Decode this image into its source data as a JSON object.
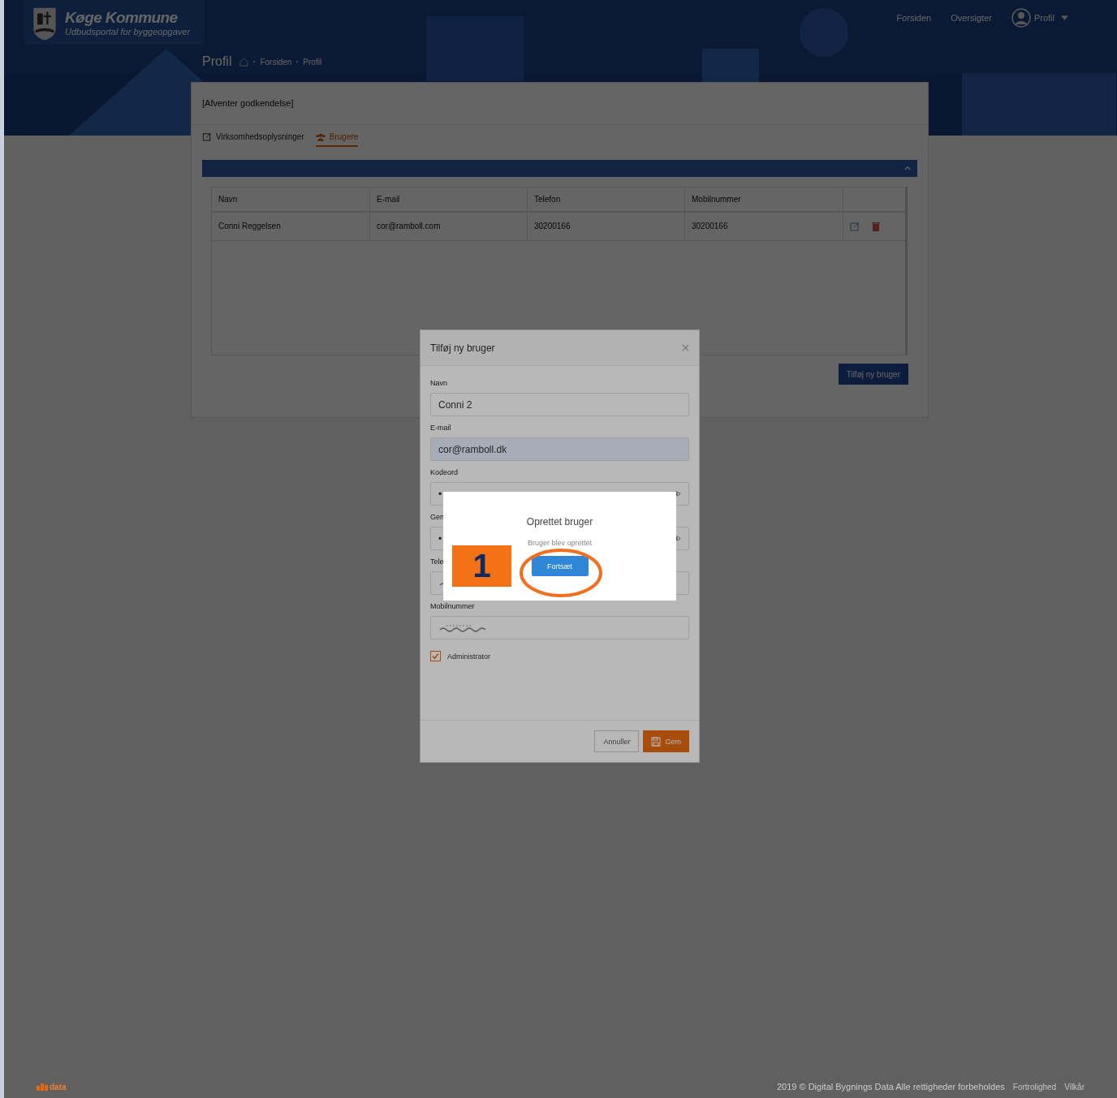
{
  "header": {
    "logo_title": "Køge Kommune",
    "logo_subtitle": "Udbudsportal for byggeopgaver",
    "nav": [
      "Forsiden",
      "Oversigter"
    ],
    "profile_menu": "Profil"
  },
  "page": {
    "title": "Profil",
    "breadcrumbs": [
      "Forsiden",
      "Profil"
    ]
  },
  "card": {
    "status": "[Afventer godkendelse]",
    "tabs": [
      {
        "label": "Virksomhedsoplysninger",
        "selected": false,
        "kind": "edit"
      },
      {
        "label": "Brugere",
        "selected": true,
        "kind": "users"
      }
    ]
  },
  "table": {
    "columns": [
      "Navn",
      "E-mail",
      "Telefon",
      "Mobilnummer"
    ],
    "rows": [
      {
        "cells": [
          "Conni Reggelsen",
          "cor@ramboll.com",
          "30200166",
          "30200166"
        ]
      }
    ]
  },
  "add_button": "Tilføj ny bruger",
  "modal": {
    "title": "Tilføj ny bruger",
    "fields": [
      {
        "label": "Navn",
        "kind": "text",
        "value": "Conni 2"
      },
      {
        "label": "E-mail",
        "kind": "autofill",
        "value": "cor@ramboll.dk"
      },
      {
        "label": "Kodeord",
        "kind": "password",
        "value": "•"
      },
      {
        "label": "Gen",
        "kind": "password",
        "value": "•"
      },
      {
        "label": "Tele",
        "kind": "redacted"
      },
      {
        "label": "Mobilnummer",
        "kind": "redacted"
      }
    ],
    "checkbox": {
      "label": "Administrator",
      "checked": true
    },
    "cancel": "Annuller",
    "save": "Gem"
  },
  "dialog": {
    "title": "Oprettet bruger",
    "message": "Bruger blev oprettet",
    "button": "Fortsæt"
  },
  "annotation": {
    "number": "1"
  },
  "footer": {
    "logo": "data",
    "copyright": "2019 © Digital Bygnings Data Alle rettigheder forbeholdes",
    "links": [
      "Fortrolighed",
      "Vilkår"
    ]
  }
}
